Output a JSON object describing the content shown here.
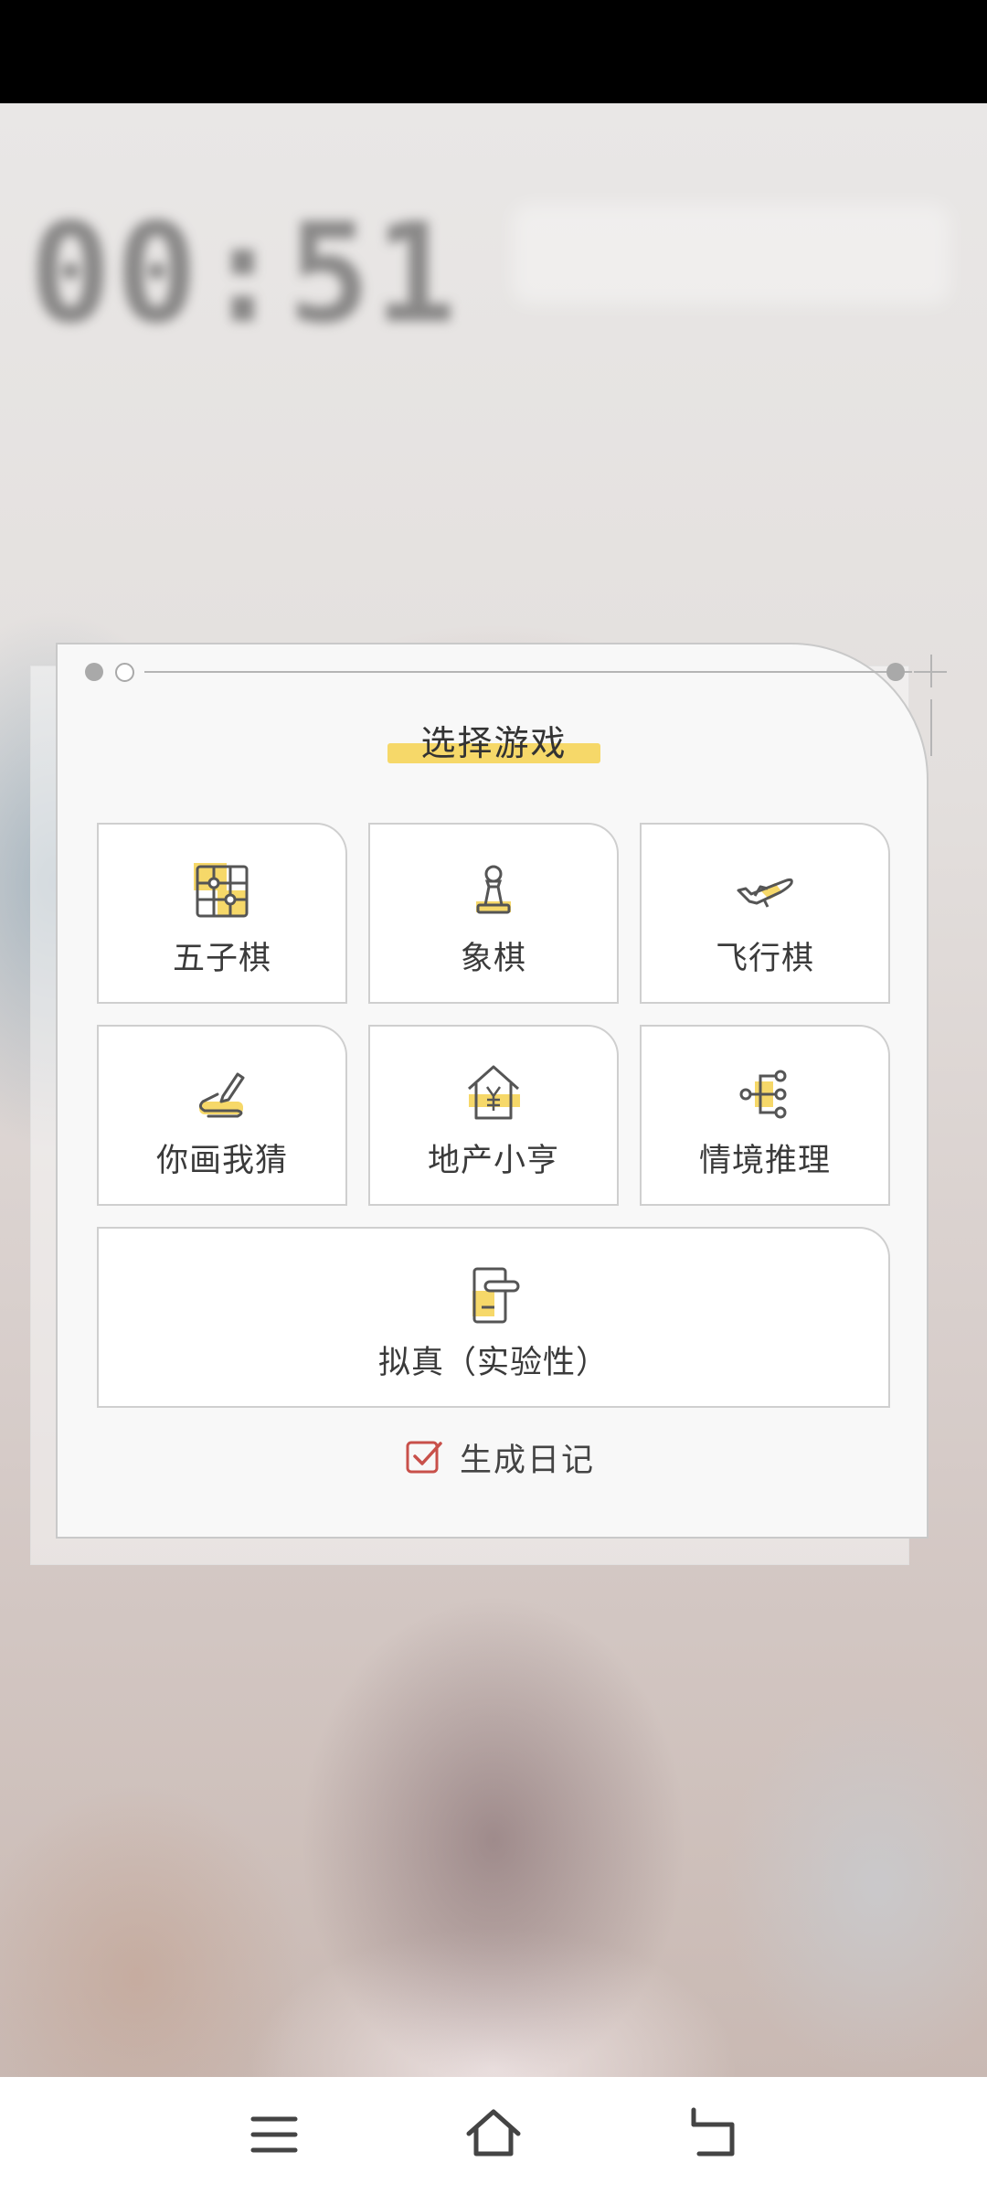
{
  "lock_screen": {
    "clock_text": "00:51"
  },
  "dialog": {
    "title": "选择游戏",
    "games": [
      {
        "label": "五子棋",
        "icon": "gomoku-board-icon"
      },
      {
        "label": "象棋",
        "icon": "chess-pawn-icon"
      },
      {
        "label": "飞行棋",
        "icon": "airplane-icon"
      },
      {
        "label": "你画我猜",
        "icon": "pencil-draw-icon"
      },
      {
        "label": "地产小亨",
        "icon": "house-yuan-icon"
      },
      {
        "label": "情境推理",
        "icon": "branch-tree-icon"
      },
      {
        "label": "拟真（实验性）",
        "icon": "door-handle-icon"
      }
    ],
    "diary_option": {
      "label": "生成日记",
      "checked": true
    }
  },
  "nav": {
    "menu_icon": "menu-icon",
    "home_icon": "home-icon",
    "back_icon": "back-icon"
  },
  "colors": {
    "accent_yellow": "#f6d869",
    "checkbox_red": "#c8504a",
    "icon_stroke": "#555555"
  }
}
